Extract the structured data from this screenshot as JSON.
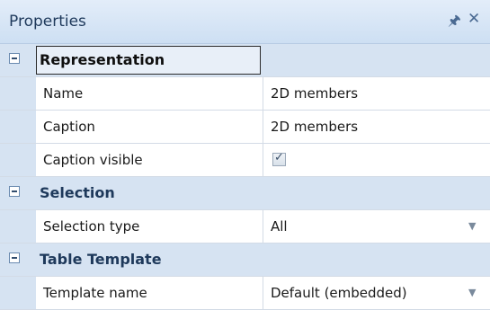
{
  "panel": {
    "title": "Properties",
    "pin_icon": "pin-icon",
    "close_icon": "close-icon"
  },
  "categories": [
    {
      "label": "Representation",
      "selected": true,
      "properties": [
        {
          "name": "Name",
          "value": "2D members",
          "type": "text"
        },
        {
          "name": "Caption",
          "value": "2D members",
          "type": "text"
        },
        {
          "name": "Caption visible",
          "value": "checked",
          "type": "checkbox"
        }
      ]
    },
    {
      "label": "Selection",
      "selected": false,
      "properties": [
        {
          "name": "Selection type",
          "value": "All",
          "type": "dropdown"
        }
      ]
    },
    {
      "label": "Table Template",
      "selected": false,
      "properties": [
        {
          "name": "Template name",
          "value": "Default (embedded)",
          "type": "dropdown"
        }
      ]
    }
  ],
  "colors": {
    "header_bg": "#d6e3f2",
    "category_text": "#1e395b",
    "grid_line": "#d3dbe6"
  }
}
